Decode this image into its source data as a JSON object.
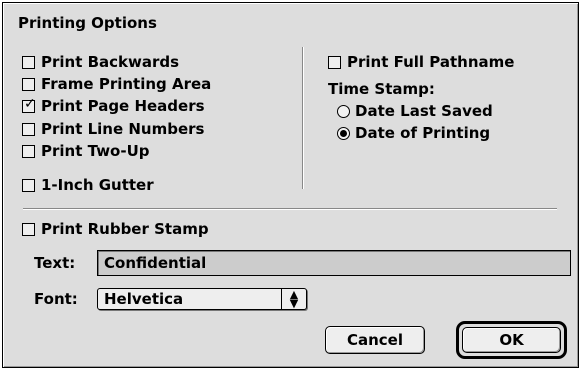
{
  "dialog": {
    "title": "Printing Options",
    "left_options": [
      {
        "label": "Print Backwards",
        "checked": false
      },
      {
        "label": "Frame Printing Area",
        "checked": false
      },
      {
        "label": "Print Page Headers",
        "checked": true
      },
      {
        "label": "Print Line Numbers",
        "checked": false
      },
      {
        "label": "Print Two-Up",
        "checked": false
      }
    ],
    "gutter": {
      "label": "1-Inch Gutter",
      "checked": false
    },
    "full_pathname": {
      "label": "Print Full Pathname",
      "checked": false
    },
    "time_stamp": {
      "label": "Time Stamp:",
      "options": [
        {
          "label": "Date Last Saved",
          "selected": false
        },
        {
          "label": "Date of Printing",
          "selected": true
        }
      ]
    },
    "rubber_stamp": {
      "label": "Print Rubber Stamp",
      "checked": false
    },
    "text_field": {
      "label": "Text:",
      "value": "Confidential"
    },
    "font_popup": {
      "label": "Font:",
      "value": "Helvetica"
    },
    "buttons": {
      "cancel": "Cancel",
      "ok": "OK"
    },
    "icons": {
      "check": "checkmark-icon",
      "popup_arrows": "up-down-arrows-icon"
    }
  }
}
